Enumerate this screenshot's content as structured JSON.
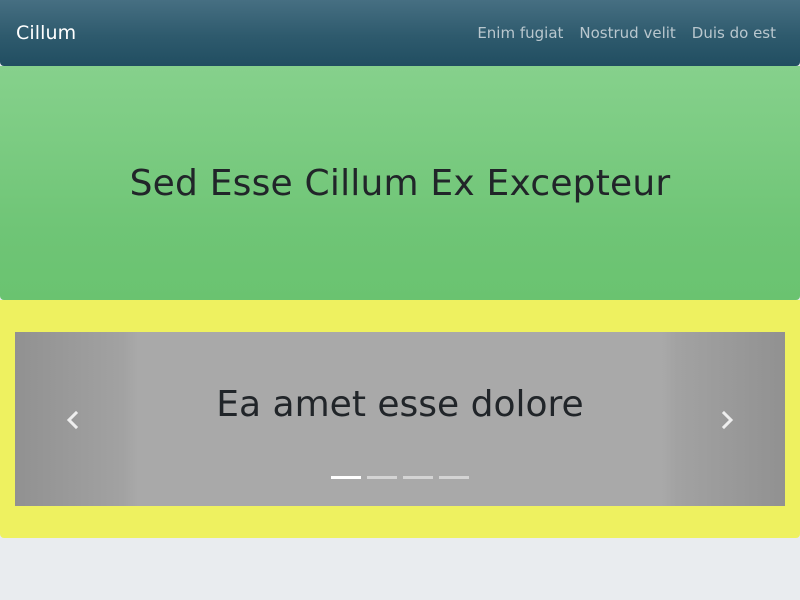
{
  "navbar": {
    "brand": "Cillum",
    "links": [
      {
        "label": "Enim fugiat"
      },
      {
        "label": "Nostrud velit"
      },
      {
        "label": "Duis do est"
      }
    ]
  },
  "hero": {
    "title": "Sed Esse Cillum Ex Excepteur"
  },
  "carousel": {
    "caption": "Ea amet esse dolore",
    "slide_count": 4,
    "active_index": 0,
    "prev_icon": "chevron-left-icon",
    "next_icon": "chevron-right-icon"
  },
  "colors": {
    "navbar": "#2e5a6d",
    "hero": "#6fc576",
    "carousel_section": "#eef160",
    "carousel_slide": "#a9a9a9",
    "page_background": "#e9ecef"
  }
}
